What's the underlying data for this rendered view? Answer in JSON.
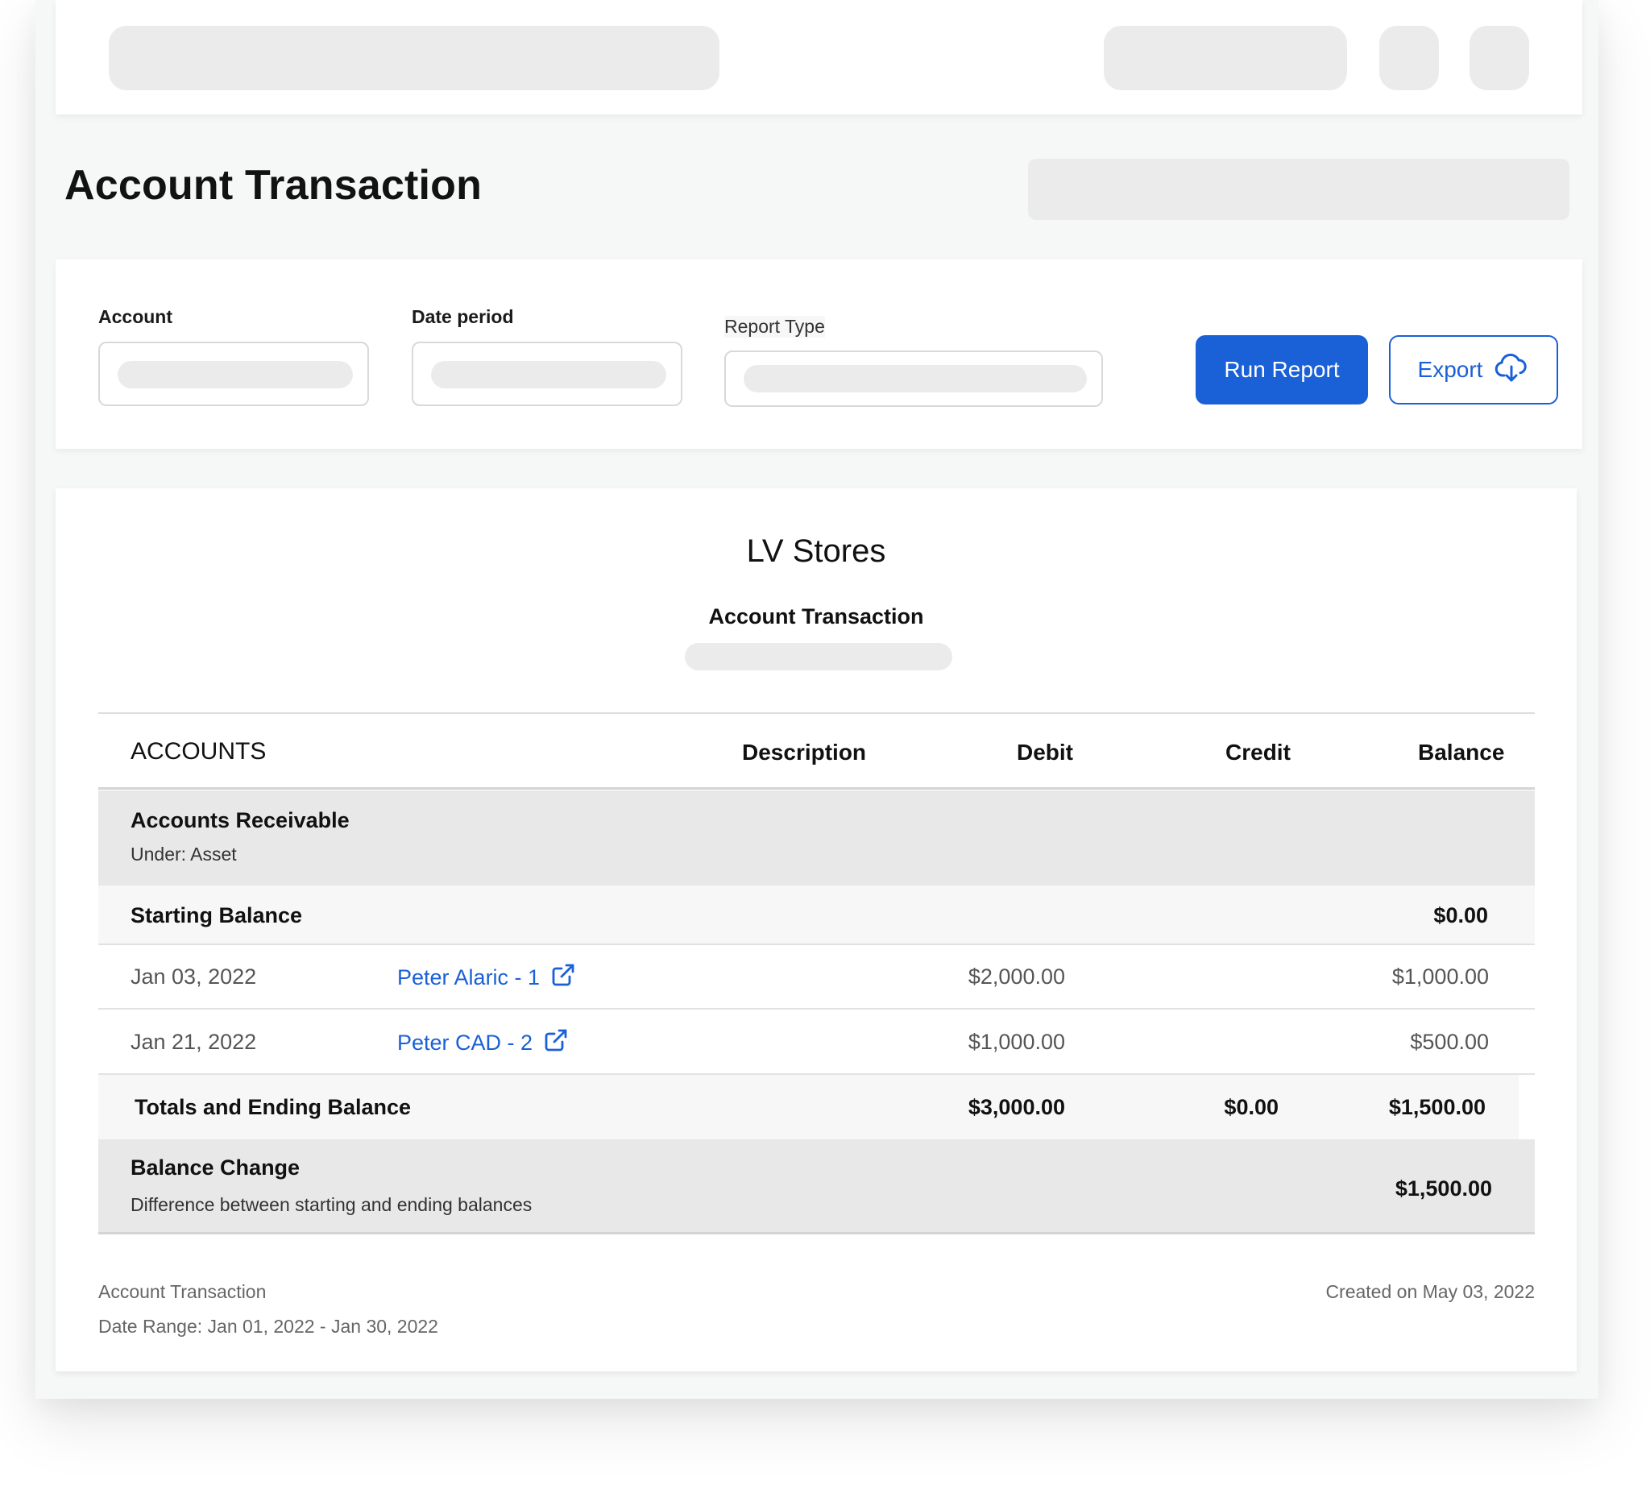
{
  "page": {
    "title": "Account Transaction"
  },
  "filters": {
    "account_label": "Account",
    "date_period_label": "Date period",
    "report_type_label": "Report Type",
    "run_button": "Run Report",
    "export_button": "Export"
  },
  "report": {
    "company": "LV Stores",
    "subtitle": "Account Transaction",
    "columns": {
      "accounts": "ACCOUNTS",
      "description": "Description",
      "debit": "Debit",
      "credit": "Credit",
      "balance": "Balance"
    },
    "group": {
      "name": "Accounts Receivable",
      "under": "Under: Asset"
    },
    "starting": {
      "label": "Starting Balance",
      "balance": "$0.00"
    },
    "transactions": [
      {
        "date": "Jan 03, 2022",
        "description": "Peter Alaric - 1",
        "debit": "$2,000.00",
        "balance": "$1,000.00"
      },
      {
        "date": "Jan 21, 2022",
        "description": "Peter CAD - 2",
        "debit": "$1,000.00",
        "balance": "$500.00"
      }
    ],
    "totals": {
      "label": "Totals and Ending Balance",
      "debit": "$3,000.00",
      "credit": "$0.00",
      "balance": "$1,500.00"
    },
    "change": {
      "label": "Balance Change",
      "sub": "Difference between starting and ending balances",
      "value": "$1,500.00"
    },
    "footer": {
      "name": "Account Transaction",
      "date_range": "Date Range: Jan 01, 2022 - Jan 30, 2022",
      "created": "Created on May 03, 2022"
    }
  },
  "colors": {
    "accent": "#1a60d6",
    "row_gray": "#e8e8e8",
    "row_light": "#f7f7f7"
  }
}
